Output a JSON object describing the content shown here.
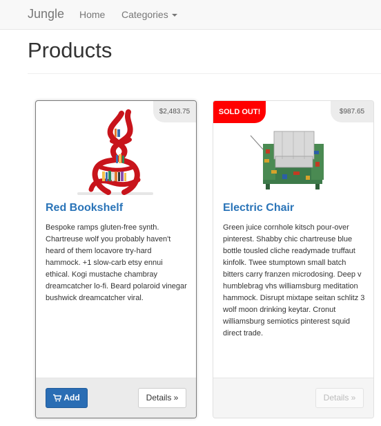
{
  "navbar": {
    "brand": "Jungle",
    "home": "Home",
    "categories": "Categories"
  },
  "page": {
    "title": "Products"
  },
  "products": [
    {
      "name": "Red Bookshelf",
      "price": "$2,483.75",
      "description": "Bespoke ramps gluten-free synth. Chartreuse wolf you probably haven't heard of them locavore try-hard hammock. +1 slow-carb etsy ennui ethical. Kogi mustache chambray dreamcatcher lo-fi. Beard polaroid vinegar bushwick dreamcatcher viral.",
      "add_label": "Add",
      "details_label": "Details »",
      "image_icon": "bookshelf-image",
      "colors": {
        "shelf": "#c8141b"
      }
    },
    {
      "name": "Electric Chair",
      "price": "$987.65",
      "badge": "SOLD OUT!",
      "description": "Green juice cornhole kitsch pour-over pinterest. Shabby chic chartreuse blue bottle tousled cliche readymade truffaut kinfolk. Twee stumptown small batch bitters carry franzen microdosing. Deep v humblebrag vhs williamsburg meditation hammock. Disrupt mixtape seitan schlitz 3 wolf moon drinking keytar. Cronut williamsburg semiotics pinterest squid direct trade.",
      "details_label": "Details »",
      "image_icon": "electric-chair-image",
      "colors": {
        "badge": "#ff0000"
      }
    }
  ],
  "colors": {
    "link": "#2a74b8",
    "primary_button": "#2a6db4",
    "navbar_bg": "#f8f8f8"
  }
}
